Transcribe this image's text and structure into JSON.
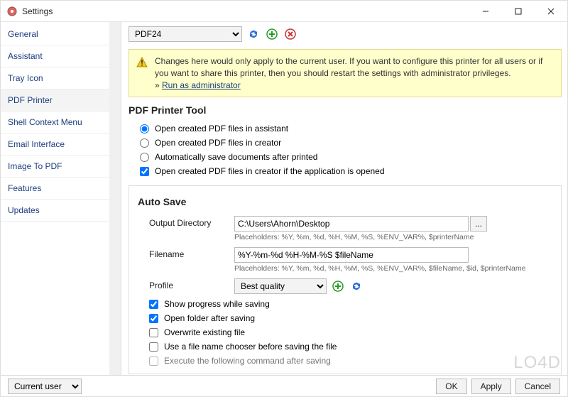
{
  "window": {
    "title": "Settings"
  },
  "sidebar": {
    "items": [
      {
        "label": "General"
      },
      {
        "label": "Assistant"
      },
      {
        "label": "Tray Icon"
      },
      {
        "label": "PDF Printer"
      },
      {
        "label": "Shell Context Menu"
      },
      {
        "label": "Email Interface"
      },
      {
        "label": "Image To PDF"
      },
      {
        "label": "Features"
      },
      {
        "label": "Updates"
      }
    ],
    "active_index": 3
  },
  "toolbar": {
    "printer_selected": "PDF24"
  },
  "notice": {
    "text": "Changes here would only apply to the current user. If you want to configure this printer for all users or if you want to share this printer, then you should restart the settings with administrator privileges.",
    "link_prefix": "» ",
    "link_text": "Run as administrator"
  },
  "section_tool": {
    "heading": "PDF Printer Tool",
    "options": [
      "Open created PDF files in assistant",
      "Open created PDF files in creator",
      "Automatically save documents after printed"
    ],
    "selected_index": 0,
    "check_label": "Open created PDF files in creator if the application is opened",
    "check_checked": true
  },
  "section_autosave": {
    "heading": "Auto Save",
    "output_dir_label": "Output Directory",
    "output_dir_value": "C:\\Users\\Ahorn\\Desktop",
    "output_dir_hint": "Placeholders: %Y, %m, %d, %H, %M, %S, %ENV_VAR%, $printerName",
    "browse_label": "...",
    "filename_label": "Filename",
    "filename_value": "%Y-%m-%d %H-%M-%S $fileName",
    "filename_hint": "Placeholders: %Y, %m, %d, %H, %M, %S, %ENV_VAR%, $fileName, $id, $printerName",
    "profile_label": "Profile",
    "profile_selected": "Best quality",
    "checks": [
      {
        "label": "Show progress while saving",
        "checked": true
      },
      {
        "label": "Open folder after saving",
        "checked": true
      },
      {
        "label": "Overwrite existing file",
        "checked": false
      },
      {
        "label": "Use a file name chooser before saving the file",
        "checked": false
      },
      {
        "label": "Execute the following command after saving",
        "checked": false
      }
    ]
  },
  "footer": {
    "scope_selected": "Current user",
    "ok": "OK",
    "apply": "Apply",
    "cancel": "Cancel"
  },
  "watermark": "LO4D"
}
